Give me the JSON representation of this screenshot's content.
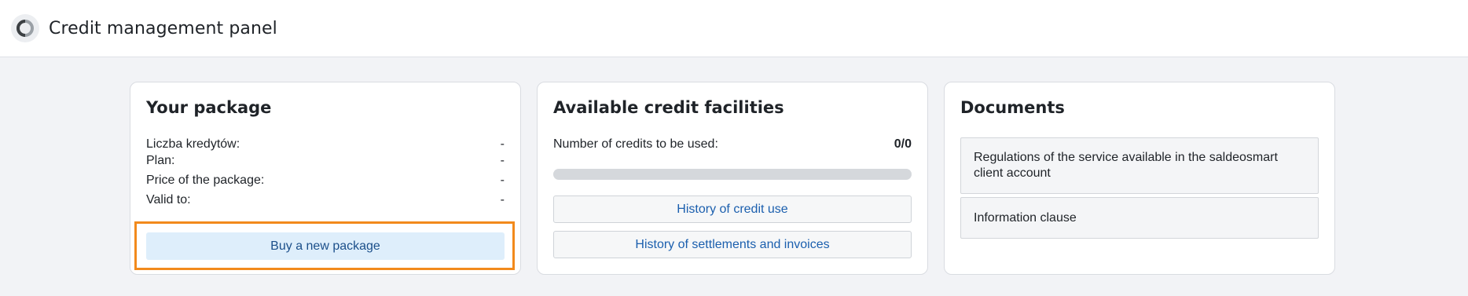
{
  "header": {
    "title": "Credit management panel",
    "logo_icon": "ring-logo-icon"
  },
  "package": {
    "title": "Your package",
    "rows": [
      {
        "label": "Liczba kredytów:",
        "value": "-"
      },
      {
        "label": "Plan:",
        "value": "-"
      },
      {
        "label": "Price of the package:",
        "value": "-"
      },
      {
        "label": "Valid to:",
        "value": "-"
      }
    ],
    "buy_button": "Buy a new package"
  },
  "facilities": {
    "title": "Available credit facilities",
    "credits_label": "Number of credits to be used:",
    "credits_value": "0/0",
    "progress_fraction": 0,
    "history_button": "History of credit use",
    "settlements_button": "History of settlements and invoices"
  },
  "documents": {
    "title": "Documents",
    "items": [
      "Regulations of the service available in the saldeosmart client account",
      "Information clause"
    ]
  },
  "colors": {
    "accent": "#1b5fae",
    "highlight": "#f28a1c",
    "primary_button_bg": "#deeefb"
  }
}
